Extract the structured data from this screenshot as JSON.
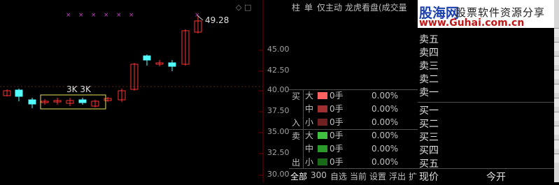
{
  "chart": {
    "price_axis": [
      "45.00",
      "42.50",
      "40.00",
      "37.50",
      "35.00",
      "32.50",
      "30.00"
    ],
    "volume_label": "3K 3K",
    "last_price": "49.28",
    "candle_color_up": "#ff3232",
    "candle_color_down": "#54ffff"
  },
  "panel": {
    "header": [
      "柱",
      "单",
      "仅主动",
      "龙虎看盘(成交量"
    ],
    "buy_side_label": [
      "买",
      "入"
    ],
    "sell_side_label": [
      "卖",
      "出"
    ],
    "rows": [
      {
        "size": "大",
        "qty": "0手",
        "pct": "0.00%",
        "color": "#ff6060"
      },
      {
        "size": "中",
        "qty": "0手",
        "pct": "0.00%",
        "color": "#a03030"
      },
      {
        "size": "小",
        "qty": "0手",
        "pct": "0.00%",
        "color": "#702020"
      },
      {
        "size": "大",
        "qty": "0手",
        "pct": "0.00%",
        "color": "#40c040"
      },
      {
        "size": "中",
        "qty": "0手",
        "pct": "0.00%",
        "color": "#2a9a2a"
      },
      {
        "size": "小",
        "qty": "0手",
        "pct": "0.00%",
        "color": "#1a6a1a"
      }
    ],
    "tabs": [
      "全部",
      "300",
      "自选",
      "当前",
      "设置",
      "浮出",
      "扩"
    ]
  },
  "orderbook": {
    "banner_brand": "股海网",
    "banner_slogan": "股票软件资源分享",
    "banner_url": "www.Guhai.com.cn",
    "sell_levels": [
      "卖五",
      "卖四",
      "卖三",
      "卖二",
      "卖一"
    ],
    "buy_levels": [
      "买一",
      "买二",
      "买三",
      "买四",
      "买五"
    ],
    "footer_left": "现价",
    "footer_right": "今开"
  }
}
